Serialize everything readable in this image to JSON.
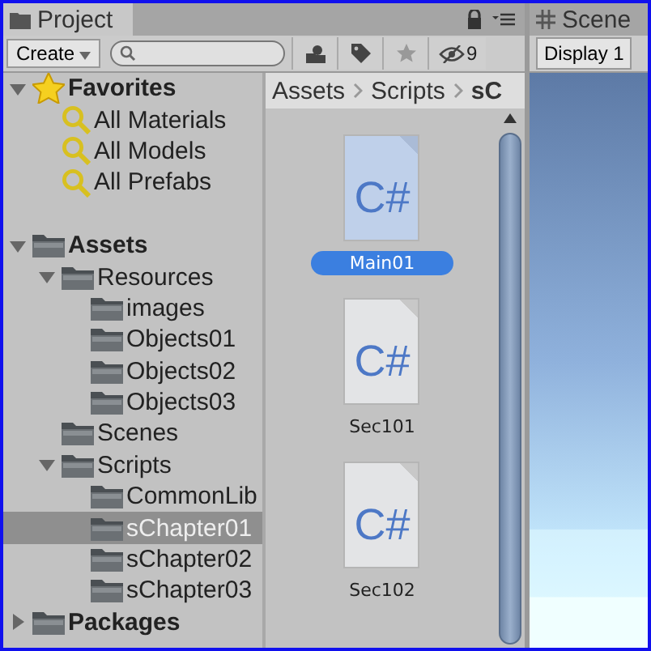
{
  "tabs": [
    {
      "label": "Project",
      "selected": true
    },
    {
      "label": "Scene",
      "selected": false
    }
  ],
  "toolbar": {
    "create": "Create",
    "hidden_count": "9"
  },
  "tree": [
    {
      "label": "Favorites",
      "kind": "star",
      "bold": true,
      "expanded": true,
      "selected": false,
      "children": [
        {
          "label": "All Materials",
          "kind": "search",
          "selected": false
        },
        {
          "label": "All Models",
          "kind": "search",
          "selected": false
        },
        {
          "label": "All Prefabs",
          "kind": "search",
          "selected": false
        }
      ]
    },
    {
      "label": "Assets",
      "kind": "folder",
      "bold": true,
      "expanded": true,
      "selected": false,
      "children": [
        {
          "label": "Resources",
          "kind": "folder",
          "expanded": true,
          "selected": false,
          "children": [
            {
              "label": "images",
              "kind": "folder",
              "selected": false
            },
            {
              "label": "Objects01",
              "kind": "folder",
              "selected": false
            },
            {
              "label": "Objects02",
              "kind": "folder",
              "selected": false
            },
            {
              "label": "Objects03",
              "kind": "folder",
              "selected": false
            }
          ]
        },
        {
          "label": "Scenes",
          "kind": "folder",
          "selected": false
        },
        {
          "label": "Scripts",
          "kind": "folder",
          "expanded": true,
          "selected": false,
          "children": [
            {
              "label": "CommonLib",
              "kind": "folder",
              "selected": false
            },
            {
              "label": "sChapter01",
              "kind": "folder",
              "selected": true
            },
            {
              "label": "sChapter02",
              "kind": "folder",
              "selected": false
            },
            {
              "label": "sChapter03",
              "kind": "folder",
              "selected": false
            }
          ]
        }
      ]
    },
    {
      "label": "Packages",
      "kind": "folder",
      "bold": true,
      "expanded": false,
      "selected": false
    }
  ],
  "breadcrumb": [
    "Assets",
    "Scripts",
    "sC"
  ],
  "files": [
    {
      "name": "Main01",
      "type": "C#",
      "selected": true
    },
    {
      "name": "Sec101",
      "type": "C#",
      "selected": false
    },
    {
      "name": "Sec102",
      "type": "C#",
      "selected": false
    }
  ],
  "scene": {
    "display": "Display 1"
  }
}
